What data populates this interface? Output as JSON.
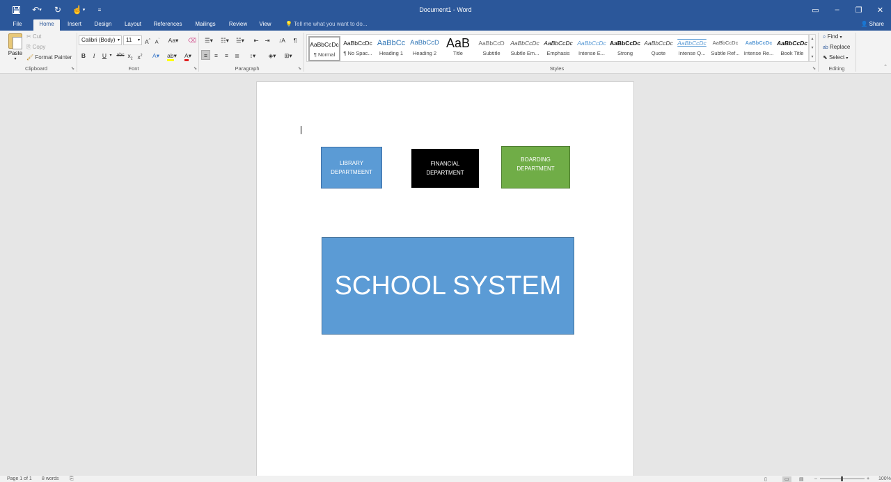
{
  "titlebar": {
    "doc_title": "Document1 - Word",
    "qat": [
      "save-icon",
      "undo-icon",
      "redo-icon",
      "touch-mode-icon",
      "customize-icon"
    ]
  },
  "tabs": [
    "File",
    "Home",
    "Insert",
    "Design",
    "Layout",
    "References",
    "Mailings",
    "Review",
    "View"
  ],
  "active_tab": "Home",
  "tell_me_placeholder": "Tell me what you want to do...",
  "share_label": "Share",
  "clipboard": {
    "paste_label": "Paste",
    "cut_label": "Cut",
    "copy_label": "Copy",
    "format_painter_label": "Format Painter",
    "group_label": "Clipboard"
  },
  "font": {
    "family": "Calibri (Body)",
    "size": "11",
    "group_label": "Font"
  },
  "paragraph": {
    "group_label": "Paragraph"
  },
  "styles": {
    "group_label": "Styles",
    "items": [
      {
        "preview": "AaBbCcDc",
        "name": "¶ Normal"
      },
      {
        "preview": "AaBbCcDc",
        "name": "¶ No Spac..."
      },
      {
        "preview": "AaBbCc",
        "name": "Heading 1"
      },
      {
        "preview": "AaBbCcD",
        "name": "Heading 2"
      },
      {
        "preview": "AaB",
        "name": "Title"
      },
      {
        "preview": "AaBbCcD",
        "name": "Subtitle"
      },
      {
        "preview": "AaBbCcDc",
        "name": "Subtle Em..."
      },
      {
        "preview": "AaBbCcDc",
        "name": "Emphasis"
      },
      {
        "preview": "AaBbCcDc",
        "name": "Intense E..."
      },
      {
        "preview": "AaBbCcDc",
        "name": "Strong"
      },
      {
        "preview": "AaBbCcDc",
        "name": "Quote"
      },
      {
        "preview": "AaBbCcDc",
        "name": "Intense Q..."
      },
      {
        "preview": "AaBbCcDc",
        "name": "Subtle Ref..."
      },
      {
        "preview": "AaBbCcDc",
        "name": "Intense Re..."
      },
      {
        "preview": "AaBbCcDc",
        "name": "Book Title"
      }
    ]
  },
  "editing": {
    "find_label": "Find",
    "replace_label": "Replace",
    "select_label": "Select",
    "group_label": "Editing"
  },
  "document": {
    "shapes": {
      "library": {
        "line1": "LIBRARY",
        "line2": "DEPARTMEENT",
        "color": "#5b9bd5"
      },
      "financial": {
        "line1": "FINANCIAL",
        "line2": "DEPARTMENT",
        "color": "#000000"
      },
      "boarding": {
        "line1": "BOARDING",
        "line2": "DEPARTMENT",
        "color": "#70ad47"
      },
      "school": {
        "text": "SCHOOL SYSTEM",
        "color": "#5b9bd5"
      }
    }
  },
  "status": {
    "page": "Page 1 of 1",
    "words": "8 words",
    "zoom": "100%"
  },
  "colors": {
    "brand": "#2b579a",
    "ribbon_bg": "#f3f3f3"
  }
}
